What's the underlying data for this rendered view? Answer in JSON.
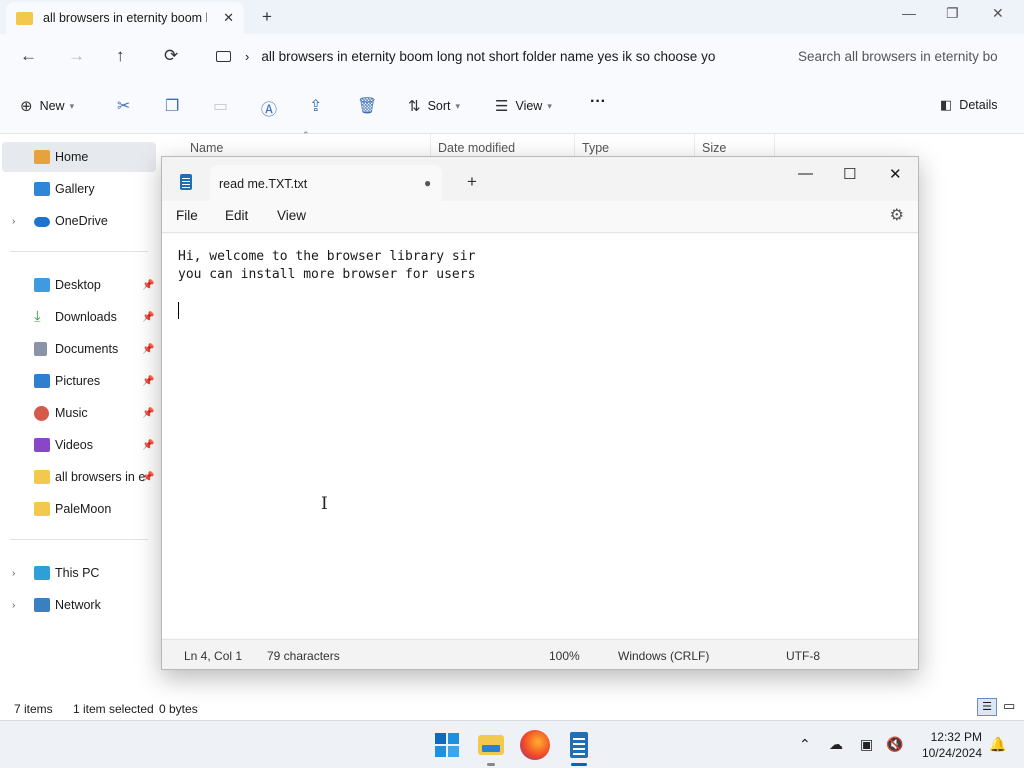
{
  "explorer": {
    "tab_title": "all browsers in eternity boom l",
    "window_controls": [
      "—",
      "❐",
      "✕"
    ],
    "path": "all browsers in eternity boom long not short folder name yes ik so choose yo",
    "search_placeholder": "Search all browsers in eternity bo",
    "toolbar": {
      "new_label": "New",
      "sort_label": "Sort",
      "view_label": "View",
      "more_label": "···",
      "details_label": "Details"
    },
    "sidebar": {
      "items": [
        {
          "label": "Home"
        },
        {
          "label": "Gallery"
        },
        {
          "label": "OneDrive"
        },
        {
          "label": "Desktop"
        },
        {
          "label": "Downloads"
        },
        {
          "label": "Documents"
        },
        {
          "label": "Pictures"
        },
        {
          "label": "Music"
        },
        {
          "label": "Videos"
        },
        {
          "label": "all browsers in e"
        },
        {
          "label": "PaleMoon"
        },
        {
          "label": "This PC"
        },
        {
          "label": "Network"
        }
      ]
    },
    "columns": [
      "Name",
      "Date modified",
      "Type",
      "Size"
    ],
    "status": {
      "item_count": "7 items",
      "selection": "1 item selected",
      "selection_size": "0 bytes"
    }
  },
  "notepad": {
    "tab_title": "read me.TXT.txt",
    "unsaved_marker": "●",
    "menu": [
      "File",
      "Edit",
      "View"
    ],
    "content_lines": [
      "Hi, welcome to the browser library sir",
      "you can install more browser for users"
    ],
    "status": {
      "position": "Ln 4, Col 1",
      "characters": "79 characters",
      "zoom": "100%",
      "line_ending": "Windows (CRLF)",
      "encoding": "UTF-8"
    }
  },
  "taskbar": {
    "time": "12:32 PM",
    "date": "10/24/2024",
    "apps": [
      "start-icon",
      "file-explorer-icon",
      "firefox-icon",
      "notepad-icon"
    ]
  },
  "colors": {
    "accent": "#0067c0",
    "folder": "#f2c94c",
    "notepad_icon": "#1f6fb8"
  }
}
